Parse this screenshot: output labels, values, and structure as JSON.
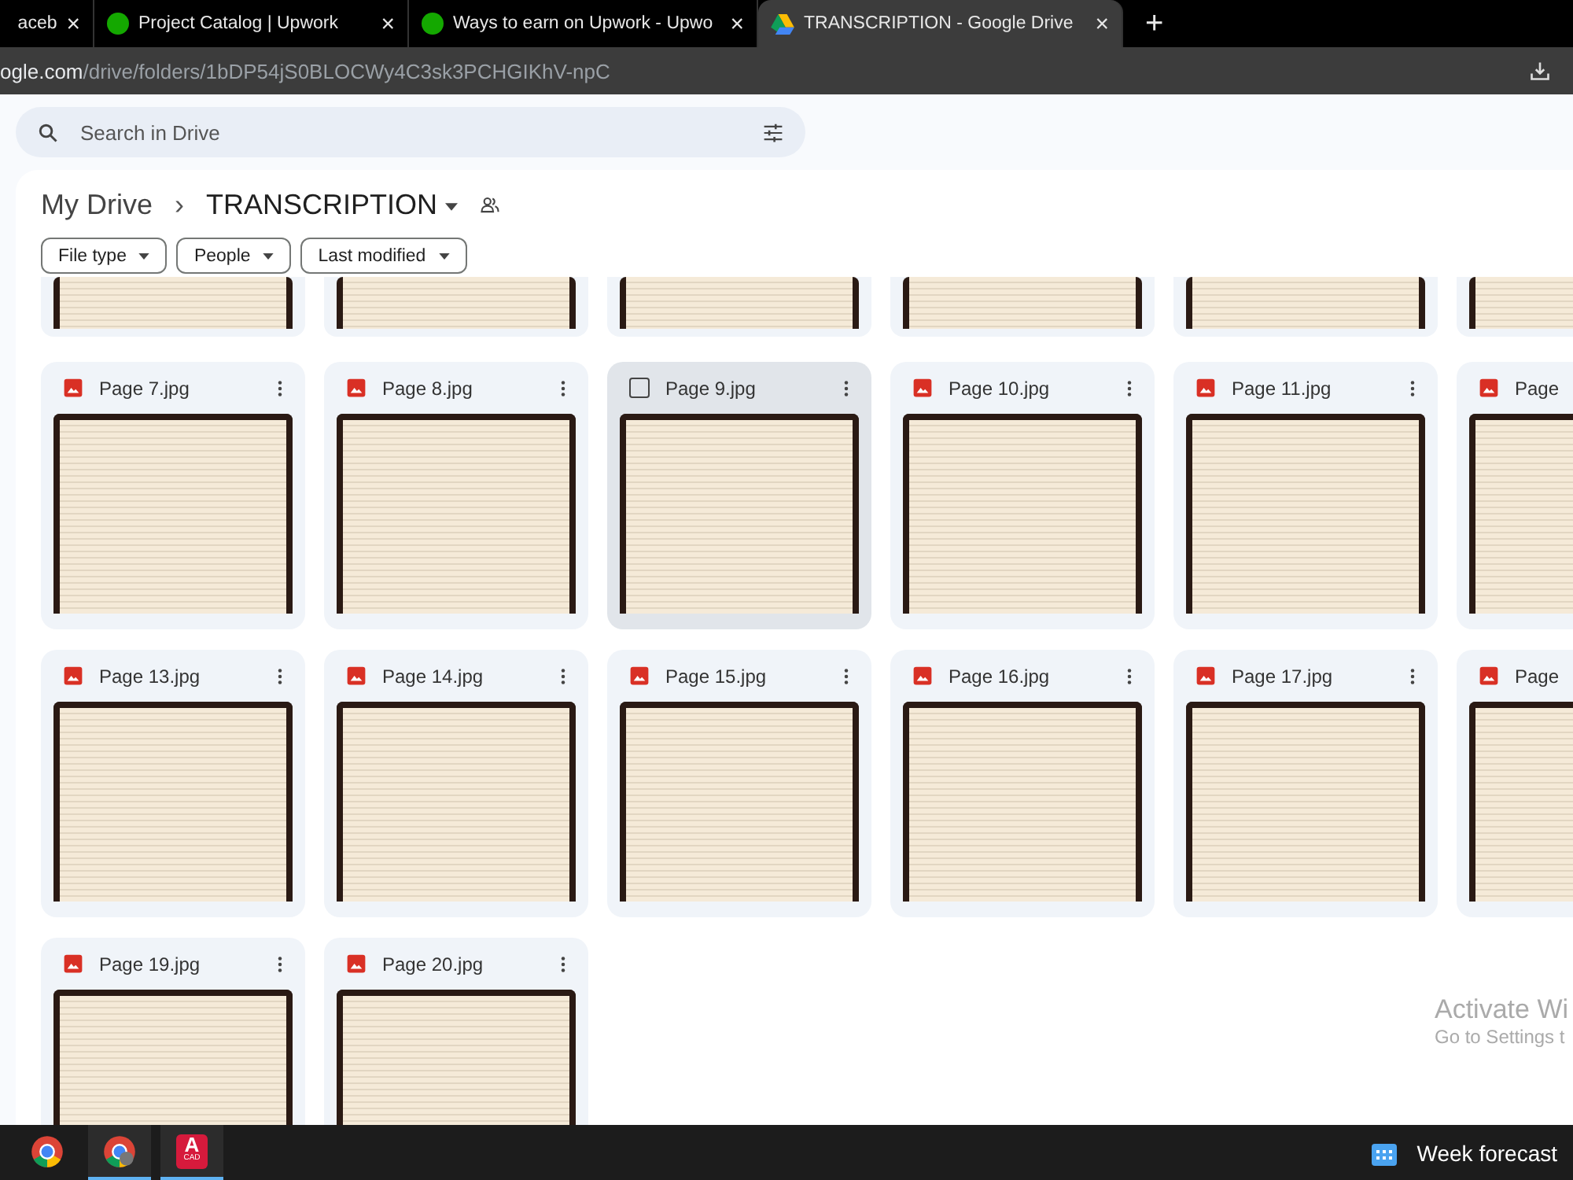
{
  "browser": {
    "tabs": [
      {
        "title": "aceb",
        "kind": "generic",
        "selected": false
      },
      {
        "title": "Project Catalog | Upwork",
        "kind": "upwork",
        "selected": false
      },
      {
        "title": "Ways to earn on Upwork - Upwo",
        "kind": "upwork",
        "selected": false
      },
      {
        "title": "TRANSCRIPTION - Google Drive",
        "kind": "drive",
        "selected": true
      }
    ],
    "new_tab": "+",
    "close": "×",
    "url_host": "ogle.com",
    "url_path": "/drive/folders/1bDP54jS0BLOCWy4C3sk3PCHGIKhV-npC"
  },
  "search": {
    "placeholder": "Search in Drive"
  },
  "breadcrumb": {
    "root": "My Drive",
    "separator": "›",
    "current": "TRANSCRIPTION"
  },
  "filters": [
    "File type",
    "People",
    "Last modified"
  ],
  "files": [
    {
      "name": "Page 7.jpg",
      "hovered": false
    },
    {
      "name": "Page 8.jpg",
      "hovered": false
    },
    {
      "name": "Page 9.jpg",
      "hovered": true
    },
    {
      "name": "Page 10.jpg",
      "hovered": false
    },
    {
      "name": "Page 11.jpg",
      "hovered": false
    },
    {
      "name": "Page",
      "hovered": false
    },
    {
      "name": "Page 13.jpg",
      "hovered": false
    },
    {
      "name": "Page 14.jpg",
      "hovered": false
    },
    {
      "name": "Page 15.jpg",
      "hovered": false
    },
    {
      "name": "Page 16.jpg",
      "hovered": false
    },
    {
      "name": "Page 17.jpg",
      "hovered": false
    },
    {
      "name": "Page",
      "hovered": false
    },
    {
      "name": "Page 19.jpg",
      "hovered": false
    },
    {
      "name": "Page 20.jpg",
      "hovered": false
    }
  ],
  "activation_notice": {
    "title": "Activate Wi",
    "subtitle": "Go to Settings t"
  },
  "taskbar": {
    "apps": [
      {
        "kind": "chrome",
        "selected": false
      },
      {
        "kind": "chrome-profile",
        "selected": true
      },
      {
        "kind": "cad",
        "label": "A",
        "sublabel": "CAD",
        "selected": true
      }
    ],
    "widget": "Week forecast"
  }
}
